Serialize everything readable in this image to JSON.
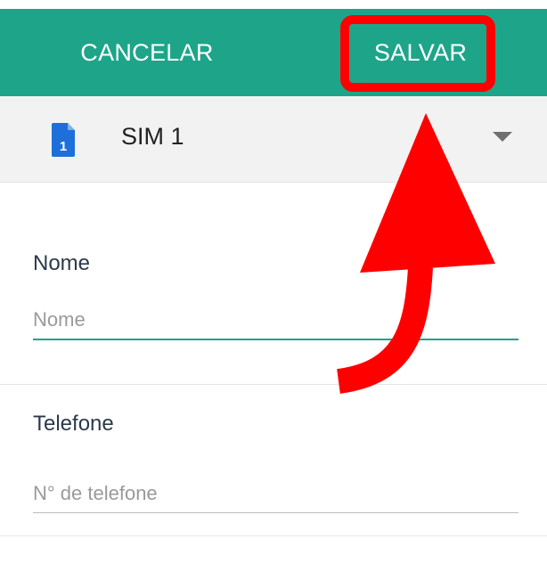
{
  "toolbar": {
    "cancel_label": "CANCELAR",
    "save_label": "SALVAR",
    "background_color": "#1ea589"
  },
  "sim_selector": {
    "icon": "sim-card-icon",
    "icon_number": "1",
    "icon_color": "#1e6fd9",
    "label": "SIM 1"
  },
  "form": {
    "name_section_label": "Nome",
    "name_placeholder": "Nome",
    "phone_section_label": "Telefone",
    "phone_placeholder": "N° de telefone"
  },
  "annotation": {
    "color": "#ff0000",
    "highlight_target": "save-button",
    "arrow_icon": "curved-arrow-up-icon"
  }
}
